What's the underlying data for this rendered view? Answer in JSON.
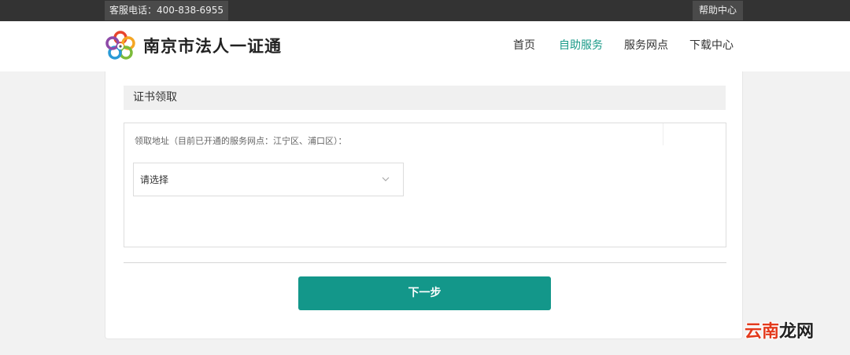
{
  "topbar": {
    "hotline": "客服电话：400-838-6955",
    "help_label": "帮助中心"
  },
  "header": {
    "site_title": "南京市法人一证通",
    "logo_icon": "flower-logo-icon",
    "nav": [
      {
        "label": "首页",
        "active": false
      },
      {
        "label": "自助服务",
        "active": true
      },
      {
        "label": "服务网点",
        "active": false
      },
      {
        "label": "下载中心",
        "active": false
      }
    ]
  },
  "main": {
    "section_title": "证书领取",
    "address_label": "领取地址（目前已开通的服务网点：江宁区、浦口区）：",
    "select": {
      "value": "请选择",
      "icon": "chevron-down-icon"
    },
    "next_button": "下一步"
  },
  "watermark": {
    "part1": "云南",
    "part2": "龙网"
  },
  "colors": {
    "accent": "#13978a",
    "nav_active": "#1a9a88",
    "topbar": "#333333",
    "watermark_red": "#e33a1c"
  }
}
